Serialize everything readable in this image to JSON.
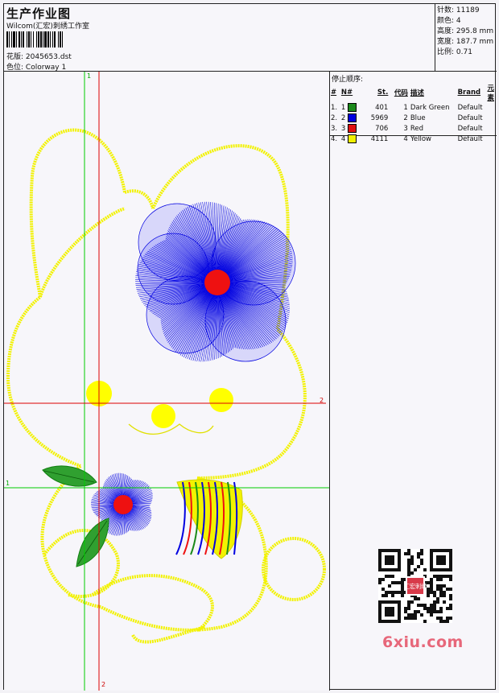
{
  "header": {
    "title": "生产作业图",
    "company": "Wilcom(汇宏)刺绣工作室",
    "design_label": "花版:",
    "design_file": "2045653.dst",
    "colorway_label": "色位:",
    "colorway": "Colorway 1"
  },
  "stats": {
    "stitches_label": "针数:",
    "stitches": "11189",
    "colors_label": "颜色:",
    "colors": "4",
    "height_label": "高度:",
    "height": "295.8 mm",
    "width_label": "宽度:",
    "width": "187.7 mm",
    "scale_label": "比例:",
    "scale": "0.71"
  },
  "stop_sequence": {
    "title": "停止顺序:",
    "headers": [
      "#",
      "N#",
      "St.",
      "代码",
      "描述",
      "Brand",
      "元素"
    ],
    "rows": [
      {
        "num": "1.",
        "n": "1",
        "color": "#1b8a1b",
        "st": "401",
        "code": "1",
        "desc": "Dark Green",
        "brand": "Default"
      },
      {
        "num": "2.",
        "n": "2",
        "color": "#0000e0",
        "st": "5969",
        "code": "2",
        "desc": "Blue",
        "brand": "Default"
      },
      {
        "num": "3.",
        "n": "3",
        "color": "#e01010",
        "st": "706",
        "code": "3",
        "desc": "Red",
        "brand": "Default"
      },
      {
        "num": "4.",
        "n": "4",
        "color": "#f0f000",
        "st": "4111",
        "code": "4",
        "desc": "Yellow",
        "brand": "Default"
      }
    ]
  },
  "guides": {
    "v1": "1",
    "h2": "2",
    "h1": "1",
    "v2": "2"
  },
  "watermark": "6xiu.com",
  "seal_text": "汇宏刺绣"
}
